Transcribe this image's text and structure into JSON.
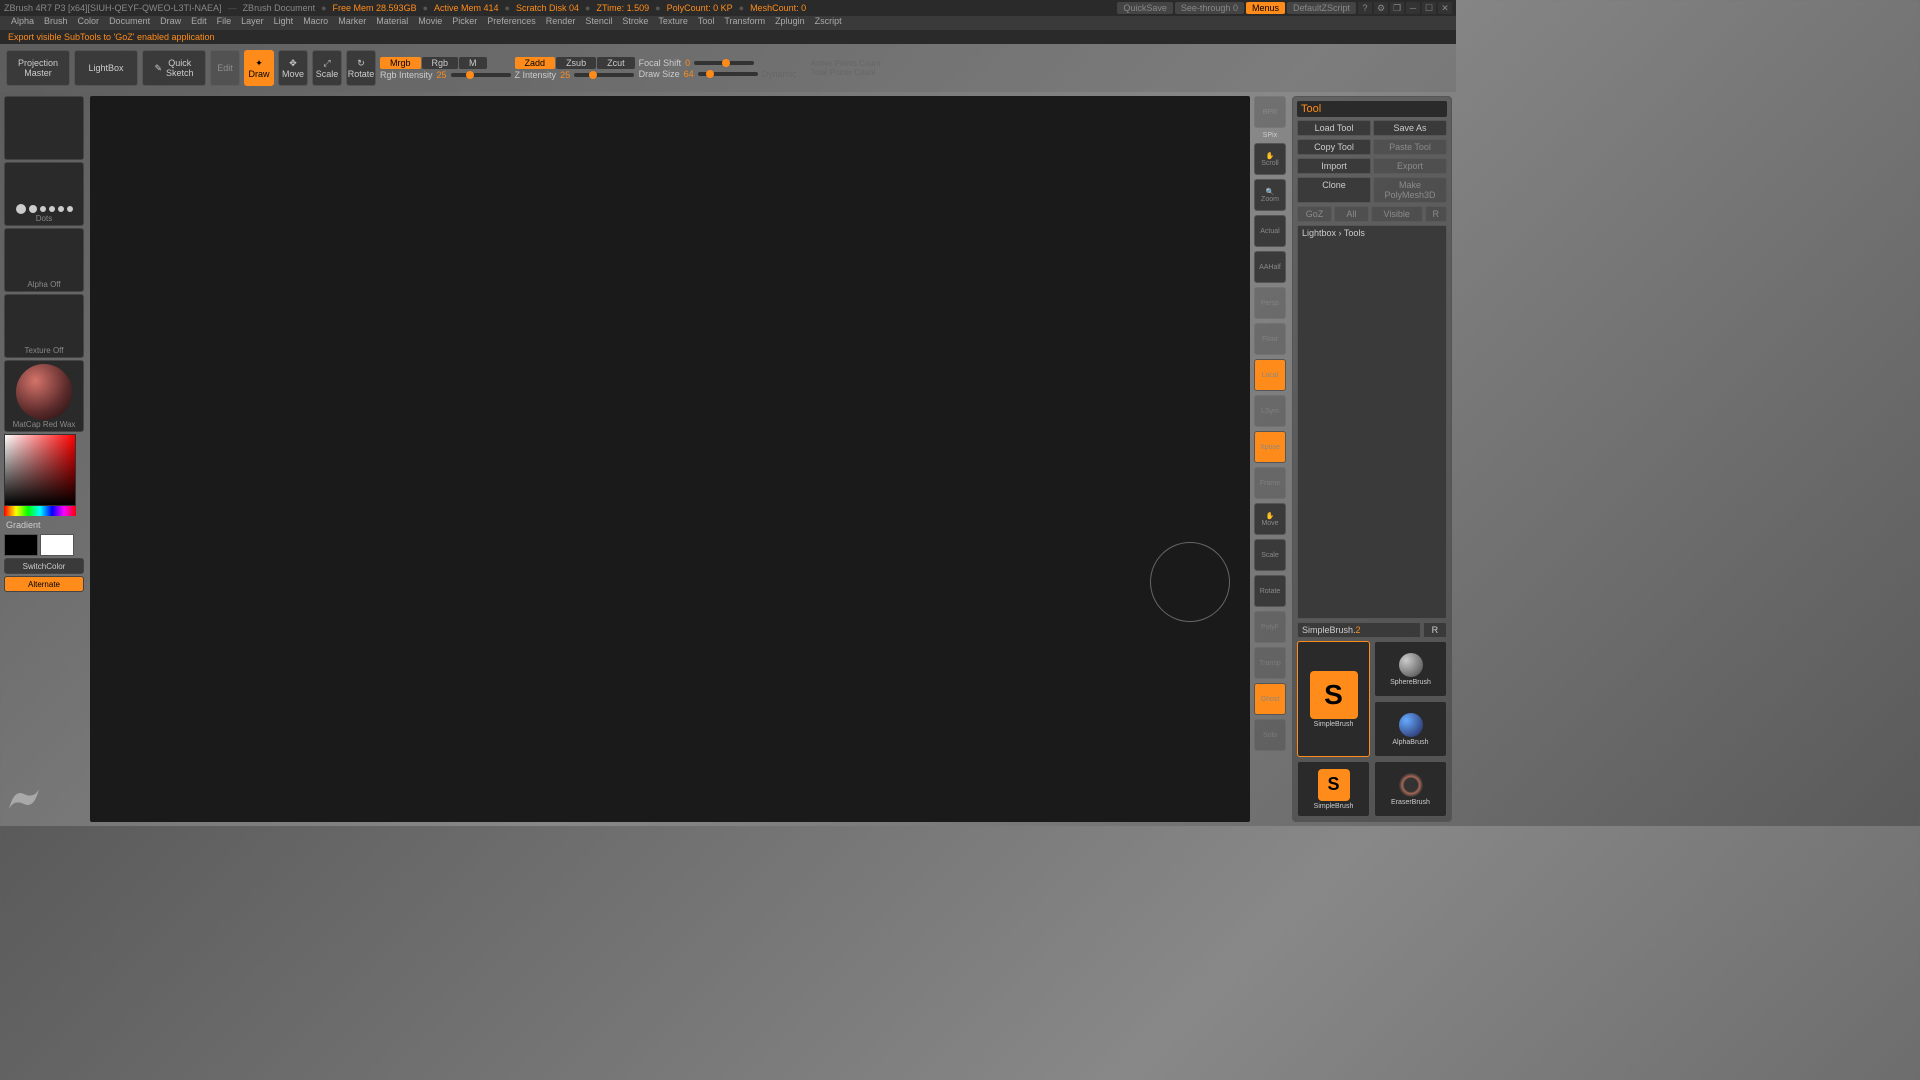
{
  "title": {
    "app": "ZBrush 4R7 P3 [x64][SIUH-QEYF-QWEO-L3TI-NAEA]",
    "doc": "ZBrush Document",
    "stats": [
      "Free Mem 28.593GB",
      "Active Mem 414",
      "Scratch Disk 04",
      "ZTime: 1.509",
      "PolyCount: 0 KP",
      "MeshCount: 0"
    ]
  },
  "titlebuttons": {
    "quicksave": "QuickSave",
    "seethrough": "See-through",
    "seethrough_val": "0",
    "menus": "Menus",
    "script": "DefaultZScript"
  },
  "menus": [
    "Alpha",
    "Brush",
    "Color",
    "Document",
    "Draw",
    "Edit",
    "File",
    "Layer",
    "Light",
    "Macro",
    "Marker",
    "Material",
    "Movie",
    "Picker",
    "Preferences",
    "Render",
    "Stencil",
    "Stroke",
    "Texture",
    "Tool",
    "Transform",
    "Zplugin",
    "Zscript"
  ],
  "status": "Export visible SubTools to 'GoZ' enabled application",
  "toolbar": {
    "projection": "Projection\nMaster",
    "lightbox": "LightBox",
    "quicksketch": "Quick\nSketch",
    "edit": "Edit",
    "draw": "Draw",
    "move": "Move",
    "scale": "Scale",
    "rotate": "Rotate",
    "mrgb": "Mrgb",
    "rgb": "Rgb",
    "m": "M",
    "rgb_intensity": "Rgb Intensity",
    "rgb_intensity_val": "25",
    "zadd": "Zadd",
    "zsub": "Zsub",
    "zcut": "Zcut",
    "z_intensity": "Z Intensity",
    "z_intensity_val": "25",
    "focal_shift": "Focal Shift",
    "focal_shift_val": "0",
    "draw_size": "Draw Size",
    "draw_size_val": "64",
    "dynamic": "Dynamic",
    "active_points": "Active Points Count",
    "total_points": "Total Points Count"
  },
  "left": {
    "brush_label": "",
    "stroke_label": "Dots",
    "alpha_label": "Alpha Off",
    "texture_label": "Texture Off",
    "material_label": "MatCap Red Wax",
    "gradient": "Gradient",
    "switchcolor": "SwitchColor",
    "alternate": "Alternate"
  },
  "rightstrip": [
    "BPR",
    "SPix",
    "Scroll",
    "Zoom",
    "Actual",
    "AAHalf",
    "Persp",
    "Floor",
    "Local",
    "LSym",
    "Xpose",
    "Frame",
    "Move",
    "Scale",
    "Rotate",
    "PolyF",
    "Transp",
    "Ghost",
    "Solo"
  ],
  "tool": {
    "header": "Tool",
    "load": "Load Tool",
    "save": "Save As",
    "copy": "Copy Tool",
    "paste": "Paste Tool",
    "import": "Import",
    "export": "Export",
    "clone": "Clone",
    "makepm": "Make PolyMesh3D",
    "goz": "GoZ",
    "all": "All",
    "visible": "Visible",
    "r": "R",
    "lightbox_tools": "Lightbox › Tools",
    "current": "SimpleBrush.",
    "current_n": "2",
    "rbtn": "R",
    "thumbs": [
      "SimpleBrush",
      "SphereBrush",
      "AlphaBrush",
      "SimpleBrush",
      "EraserBrush"
    ]
  }
}
